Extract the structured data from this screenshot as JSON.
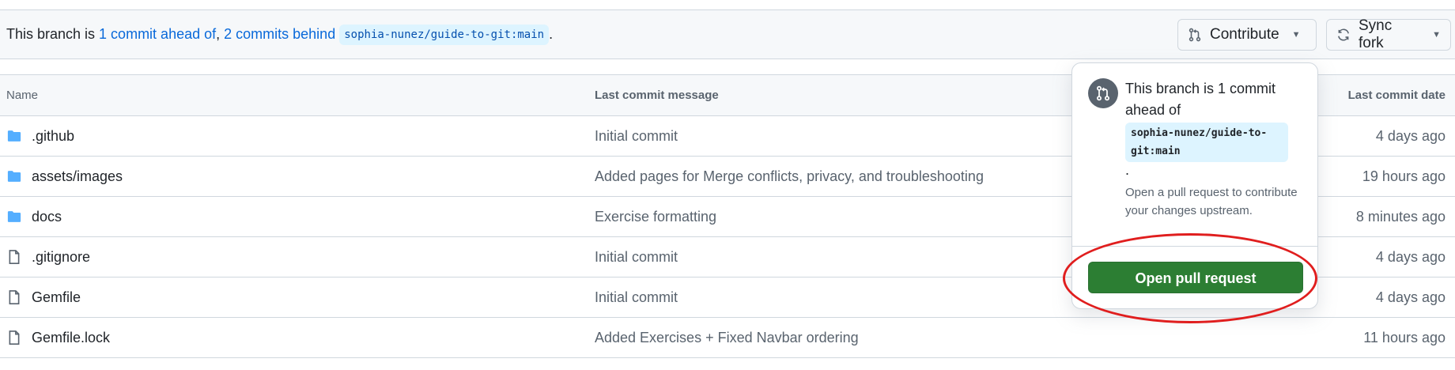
{
  "banner": {
    "prefix": "This branch is ",
    "ahead_link": "1 commit ahead of",
    "separator": ", ",
    "behind_link": "2 commits behind",
    "upstream": "sophia-nunez/guide-to-git:main",
    "suffix": "."
  },
  "buttons": {
    "contribute": "Contribute",
    "sync_fork": "Sync fork"
  },
  "table": {
    "headers": {
      "name": "Name",
      "message": "Last commit message",
      "date": "Last commit date"
    },
    "rows": [
      {
        "type": "folder",
        "name": ".github",
        "message": "Initial commit",
        "date": "4 days ago"
      },
      {
        "type": "folder",
        "name": "assets/images",
        "message": "Added pages for Merge conflicts, privacy, and troubleshooting",
        "date": "19 hours ago"
      },
      {
        "type": "folder",
        "name": "docs",
        "message": "Exercise formatting",
        "date": "8 minutes ago"
      },
      {
        "type": "file",
        "name": ".gitignore",
        "message": "Initial commit",
        "date": "4 days ago"
      },
      {
        "type": "file",
        "name": "Gemfile",
        "message": "Initial commit",
        "date": "4 days ago"
      },
      {
        "type": "file",
        "name": "Gemfile.lock",
        "message": "Added Exercises + Fixed Navbar ordering",
        "date": "11 hours ago"
      }
    ]
  },
  "popover": {
    "title": "This branch is 1 commit ahead of",
    "upstream": "sophia-nunez/guide-to-git:main",
    "title_suffix": ".",
    "description": "Open a pull request to contribute your changes upstream.",
    "button": "Open pull request"
  },
  "colors": {
    "link": "#0969da",
    "primary_button": "#2c7e33",
    "annotation": "#e01e1e",
    "folder_icon": "#54aeff"
  },
  "icons": {
    "contribute": "git-pull-request-icon",
    "sync": "sync-icon",
    "folder": "folder-icon",
    "file": "file-icon"
  }
}
